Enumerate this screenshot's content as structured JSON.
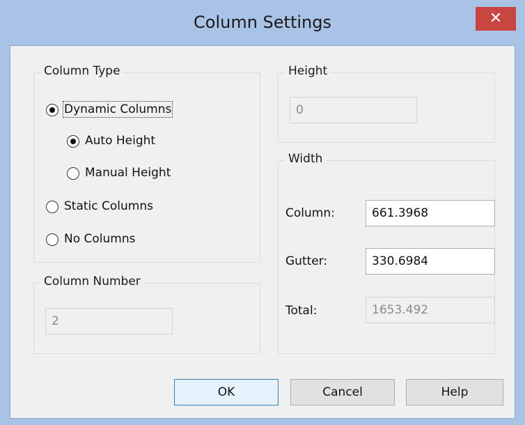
{
  "window": {
    "title": "Column Settings",
    "close_glyph": "✕"
  },
  "column_type": {
    "label": "Column Type",
    "dynamic": "Dynamic Columns",
    "auto_height": "Auto Height",
    "manual_height": "Manual Height",
    "static": "Static Columns",
    "none": "No Columns",
    "selected": "Dynamic Columns",
    "selected_height_mode": "Auto Height"
  },
  "column_number": {
    "label": "Column Number",
    "value": "2"
  },
  "height": {
    "label": "Height",
    "value": "0"
  },
  "width": {
    "label": "Width",
    "column_label": "Column:",
    "column_value": "661.3968",
    "gutter_label": "Gutter:",
    "gutter_value": "330.6984",
    "total_label": "Total:",
    "total_value": "1653.492"
  },
  "buttons": {
    "ok": "OK",
    "cancel": "Cancel",
    "help": "Help"
  },
  "colors": {
    "accent": "#a9c3e6",
    "close": "#c7463f",
    "panel": "#f0f0f0"
  }
}
